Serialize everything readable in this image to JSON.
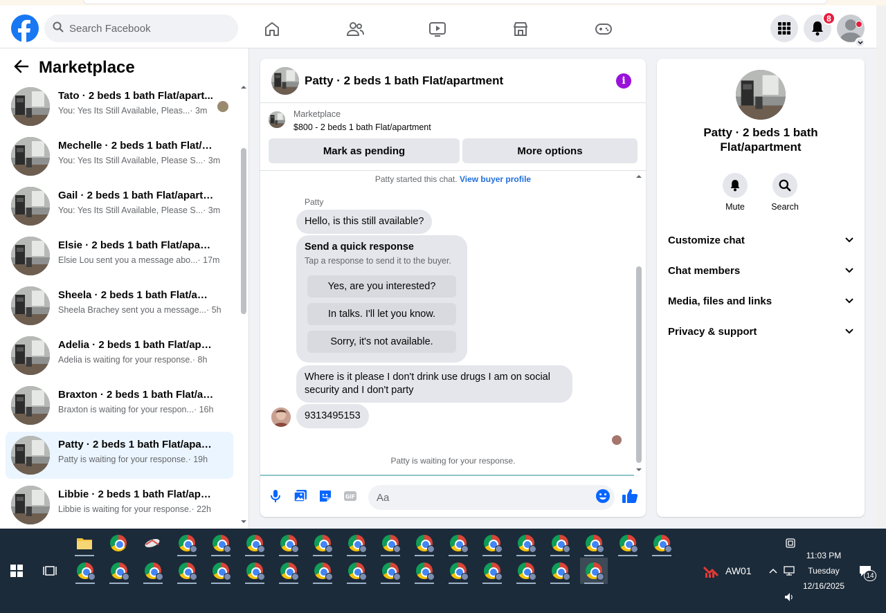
{
  "topbar": {
    "search_placeholder": "Search Facebook",
    "notifications_count": "8"
  },
  "left": {
    "title": "Marketplace",
    "conversations": [
      {
        "title": "Tato · 2 beds 1 bath Flat/apart...",
        "snippet": "You: Yes Its Still Available, Pleas...",
        "time": " · 3m",
        "active": false
      },
      {
        "title": "Mechelle · 2 beds 1 bath Flat/ap...",
        "snippet": "You: Yes Its Still Available, Please S...",
        "time": " · 3m",
        "active": false
      },
      {
        "title": "Gail · 2 beds 1 bath Flat/apartme...",
        "snippet": "You: Yes Its Still Available, Please S...",
        "time": " · 3m",
        "active": false
      },
      {
        "title": "Elsie · 2 beds 1 bath Flat/apartm...",
        "snippet": "Elsie Lou sent you a message abo...",
        "time": " · 17m",
        "active": false
      },
      {
        "title": "Sheela · 2 beds 1 bath Flat/apart...",
        "snippet": "Sheela Brachey sent you a message...",
        "time": " · 5h",
        "active": false
      },
      {
        "title": "Adelia · 2 beds 1 bath Flat/apart...",
        "snippet": "Adelia is waiting for your response.",
        "time": " · 8h",
        "active": false
      },
      {
        "title": "Braxton · 2 beds 1 bath Flat/apar...",
        "snippet": "Braxton is waiting for your respon...",
        "time": " · 16h",
        "active": false
      },
      {
        "title": "Patty · 2 beds 1 bath Flat/apart...",
        "snippet": "Patty is waiting for your response.",
        "time": " · 19h",
        "active": true
      },
      {
        "title": "Libbie · 2 beds 1 bath Flat/apart...",
        "snippet": "Libbie is waiting for your response.",
        "time": " · 22h",
        "active": false
      }
    ]
  },
  "chat": {
    "header_title": "Patty · 2 beds 1 bath Flat/apartment",
    "listing_source": "Marketplace",
    "listing_price_title": "$800 - 2 beds 1 bath Flat/apartment",
    "mark_pending": "Mark as pending",
    "more_options": "More options",
    "started_text": "Patty started this chat.",
    "view_buyer": "View buyer profile",
    "sender_name": "Patty",
    "msg1": "Hello, is this still available?",
    "quick_title": "Send a quick response",
    "quick_sub": "Tap a response to send it to the buyer.",
    "quick_options": [
      "Yes, are you interested?",
      "In talks. I'll let you know.",
      "Sorry, it's not available."
    ],
    "msg2_line1": "Where is it please I don't drink use drugs I am on social",
    "msg2_line2": "security and I don't party",
    "msg3": "9313495153",
    "waiting": "Patty is waiting for your response.",
    "input_placeholder": "Aa"
  },
  "info": {
    "name_line1": "Patty · 2 beds 1 bath",
    "name_line2": "Flat/apartment",
    "mute": "Mute",
    "search": "Search",
    "rows": [
      "Customize chat",
      "Chat members",
      "Media, files and links",
      "Privacy & support"
    ]
  },
  "taskbar": {
    "profile_label": "AW01",
    "time": "11:03 PM",
    "day": "Tuesday",
    "date": "12/16/2025",
    "notif_count": "14"
  },
  "colors": {
    "brand": "#1877f2",
    "accent_purple": "#9a12d9",
    "active_conv_bg": "#ebf5ff",
    "badge_red": "#e41e3f"
  }
}
